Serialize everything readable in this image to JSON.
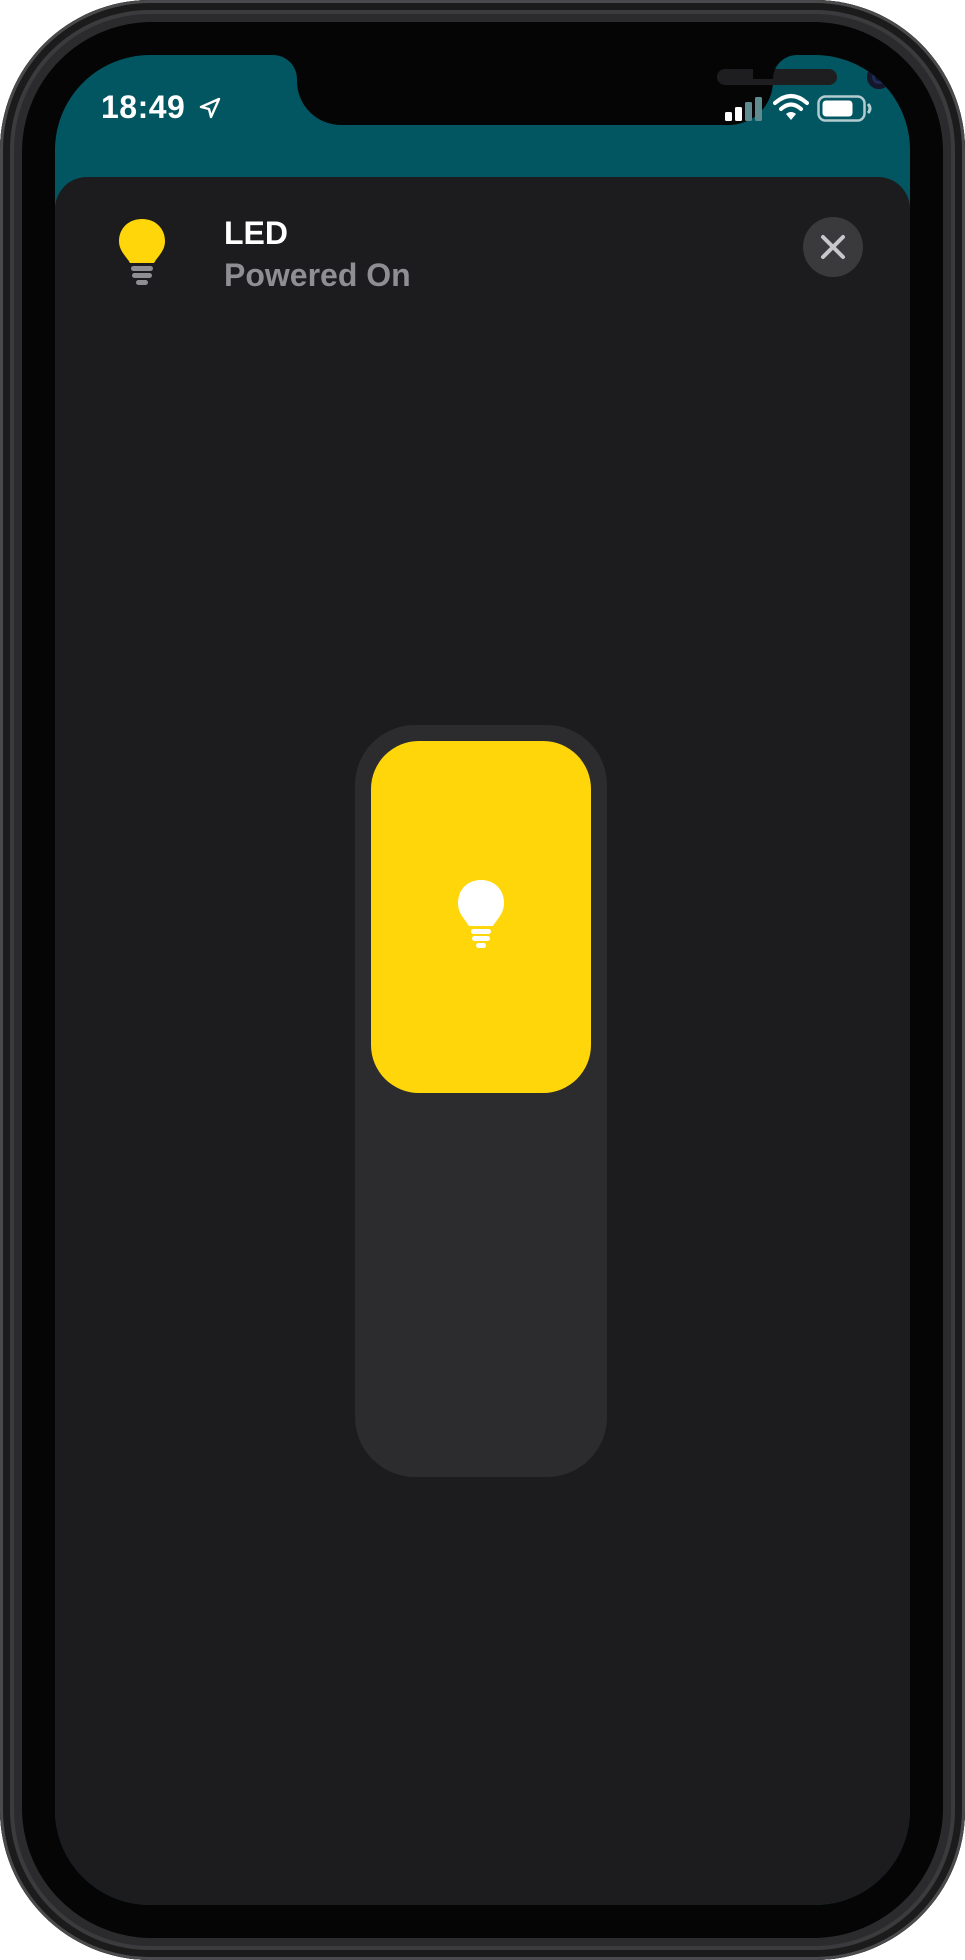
{
  "status_bar": {
    "time": "18:49",
    "icons": [
      "location-arrow-icon",
      "cellular-signal-icon",
      "wifi-icon",
      "battery-icon"
    ]
  },
  "accessory": {
    "name": "LED",
    "state": "Powered On",
    "icon": "lightbulb-icon",
    "brightness_fraction": 0.48
  },
  "controls": {
    "close_icon": "close-icon",
    "settings_icon": "gear-icon"
  },
  "colors": {
    "accent_yellow": "#ffd60a",
    "sheet_background": "#1c1c1e",
    "status_bar_teal": "#025662",
    "track": "#2c2c2e",
    "secondary_text": "#8e8e93"
  }
}
